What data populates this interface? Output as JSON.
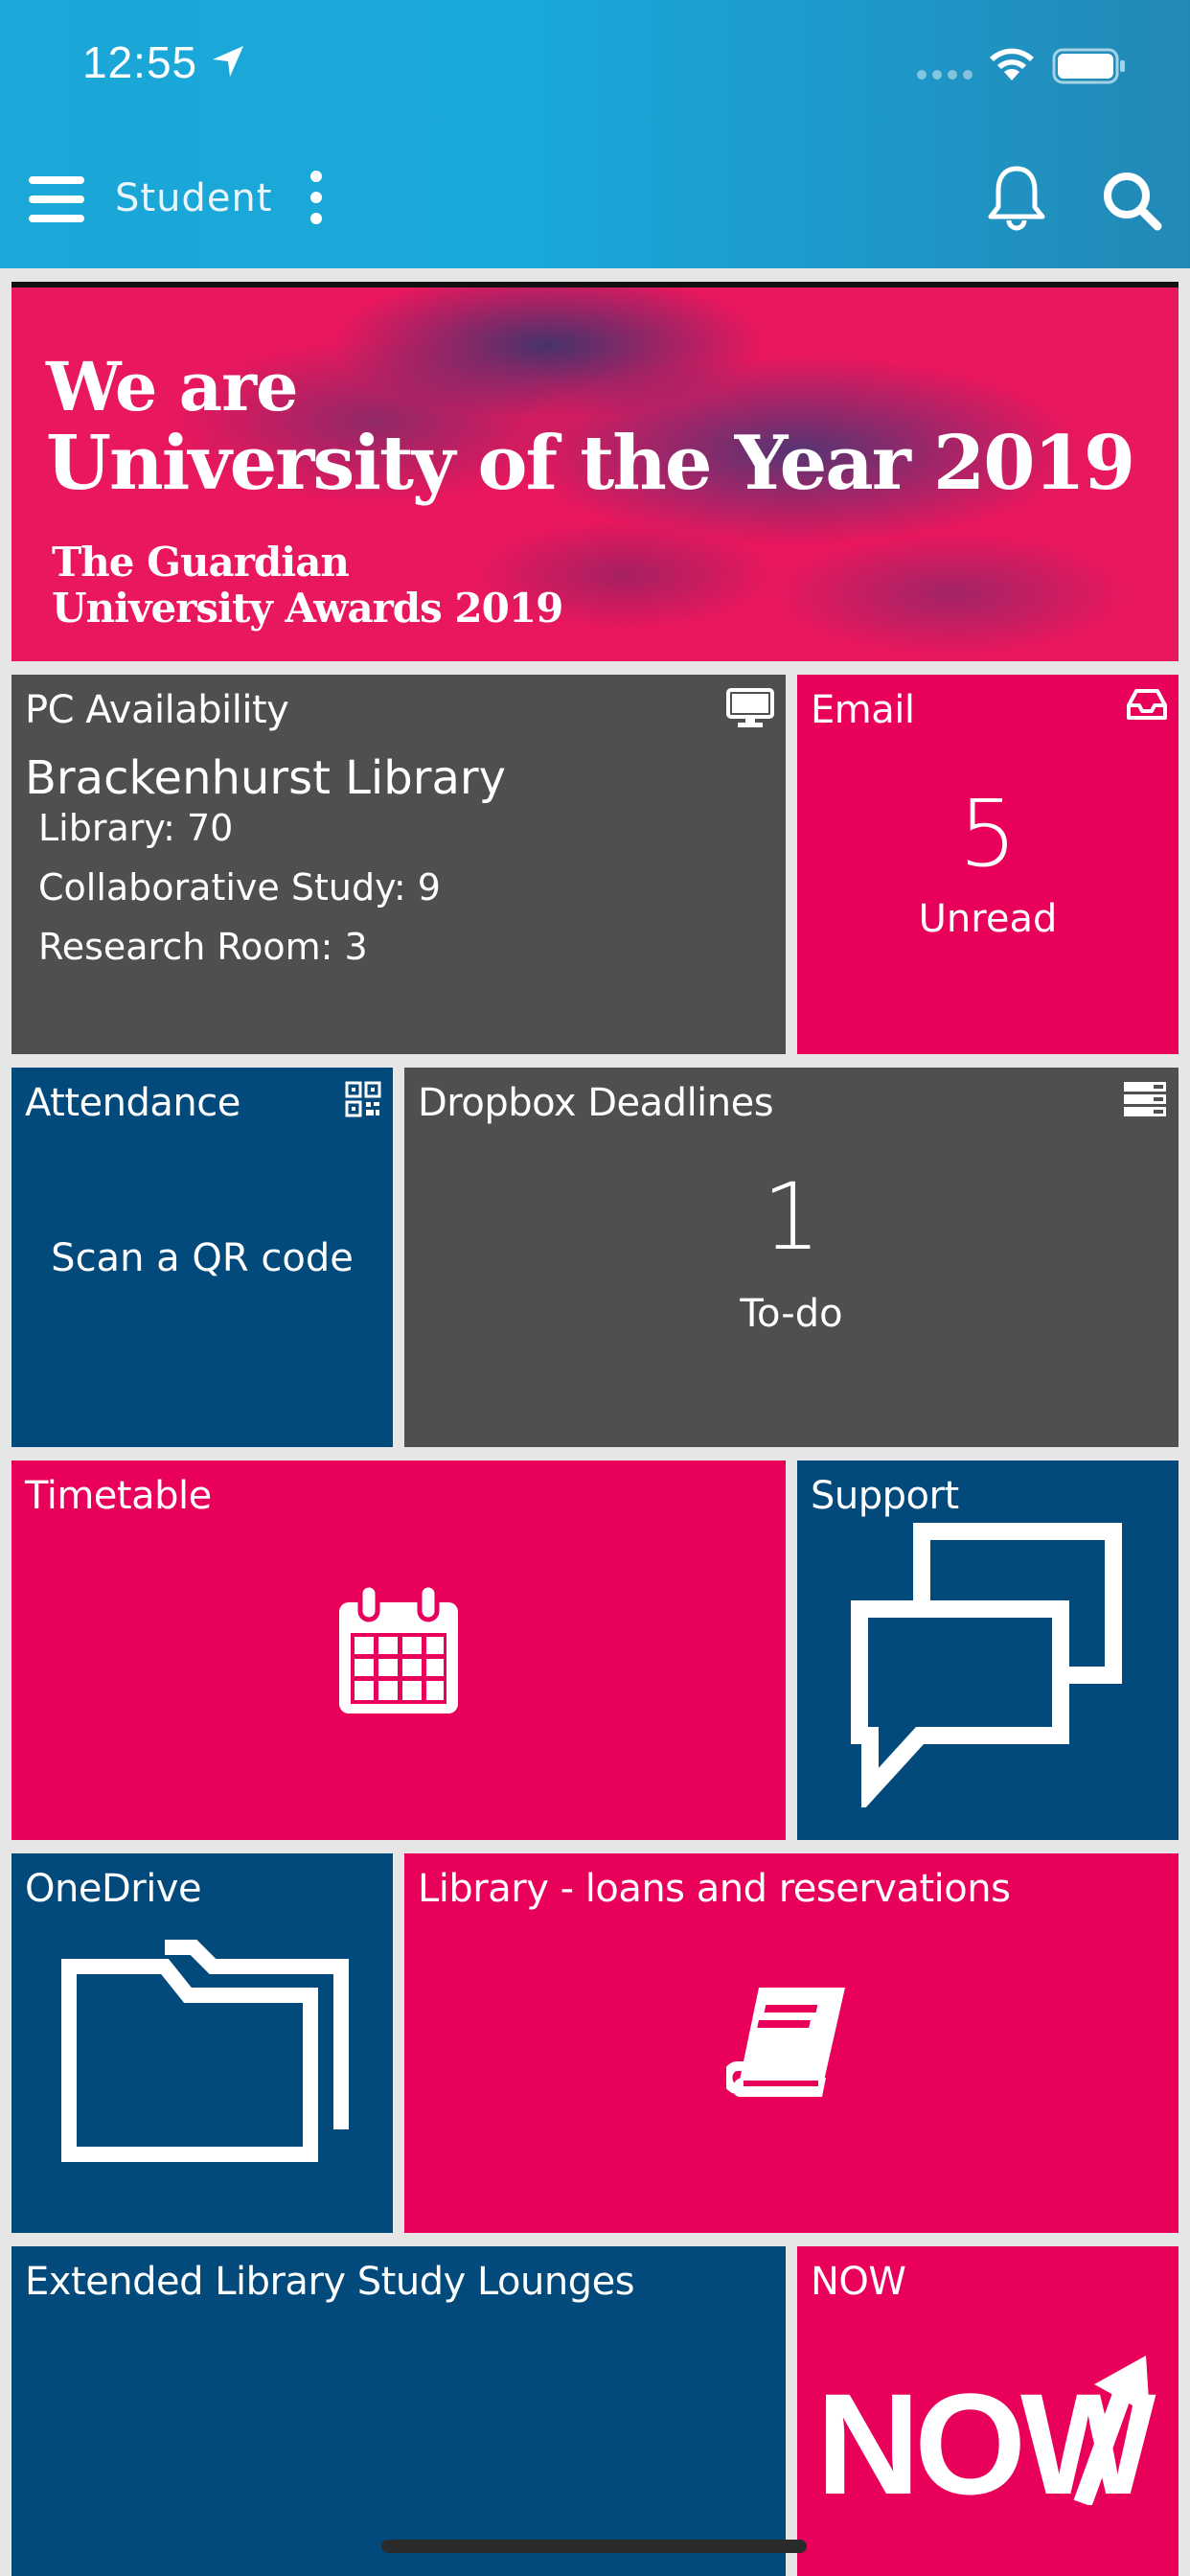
{
  "status_bar": {
    "time": "12:55"
  },
  "header": {
    "title": "Student"
  },
  "banner": {
    "line1": "We are",
    "line2": "University of the Year 2019",
    "line3": "The Guardian",
    "line4": "University Awards 2019"
  },
  "tiles": {
    "pc_availability": {
      "title": "PC Availability",
      "location": "Brackenhurst Library",
      "lines": [
        "Library: 70",
        "Collaborative Study: 9",
        "Research Room: 3"
      ],
      "icon": "monitor-icon"
    },
    "email": {
      "title": "Email",
      "count": "5",
      "caption": "Unread",
      "icon": "inbox-icon"
    },
    "attendance": {
      "title": "Attendance",
      "text": "Scan a QR code",
      "icon": "qr-code-icon"
    },
    "dropbox": {
      "title": "Dropbox Deadlines",
      "count": "1",
      "caption": "To-do",
      "icon": "server-icon"
    },
    "timetable": {
      "title": "Timetable",
      "icon": "calendar-icon"
    },
    "support": {
      "title": "Support",
      "icon": "chat-bubbles-icon"
    },
    "onedrive": {
      "title": "OneDrive",
      "icon": "folders-icon"
    },
    "library": {
      "title": "Library - loans and reservations",
      "icon": "book-icon"
    },
    "lounges": {
      "title": "Extended Library Study Lounges"
    },
    "now": {
      "title": "NOW",
      "logo_text": "NOW"
    }
  },
  "colors": {
    "header": "#1ba7d8",
    "pink": "#e8005a",
    "navy": "#024a7b",
    "gray": "#4f4f4f",
    "background": "#e6e6e6"
  }
}
